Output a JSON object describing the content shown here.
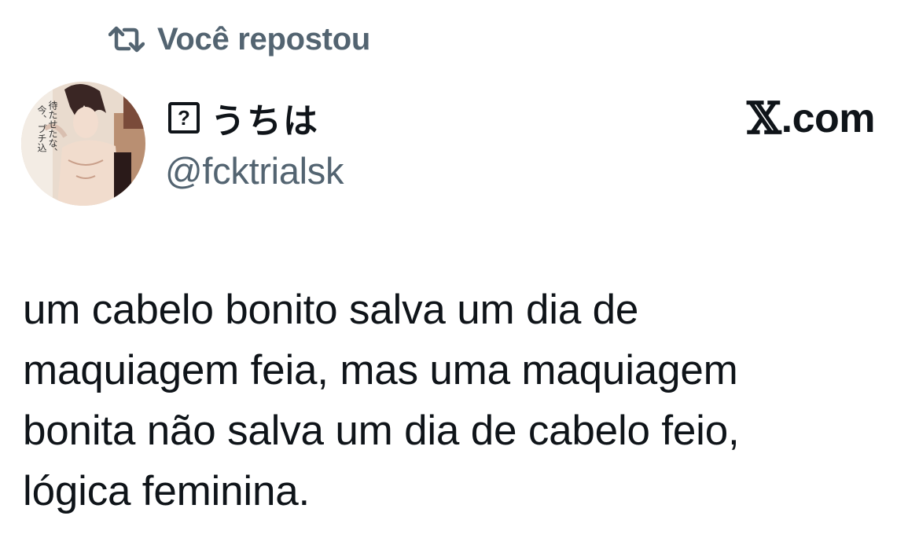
{
  "repost": {
    "icon": "repost-icon",
    "label": "Você repostou"
  },
  "author": {
    "avatar": "avatar-image",
    "name_prefix_glyph": "?",
    "display_name": "うちは",
    "handle": "@fcktrialsk",
    "avatar_caption": "待たせたな、今、ブチ込んでやる"
  },
  "brand": {
    "x_glyph": "𝕏",
    "suffix": ".com"
  },
  "tweet": {
    "lines": [
      "um cabelo bonito salva um dia de",
      "maquiagem feia, mas uma maquiagem",
      "bonita não salva um dia de cabelo feio,",
      "lógica feminina."
    ]
  },
  "colors": {
    "text": "#0f1419",
    "secondary": "#536471",
    "background": "#ffffff"
  }
}
